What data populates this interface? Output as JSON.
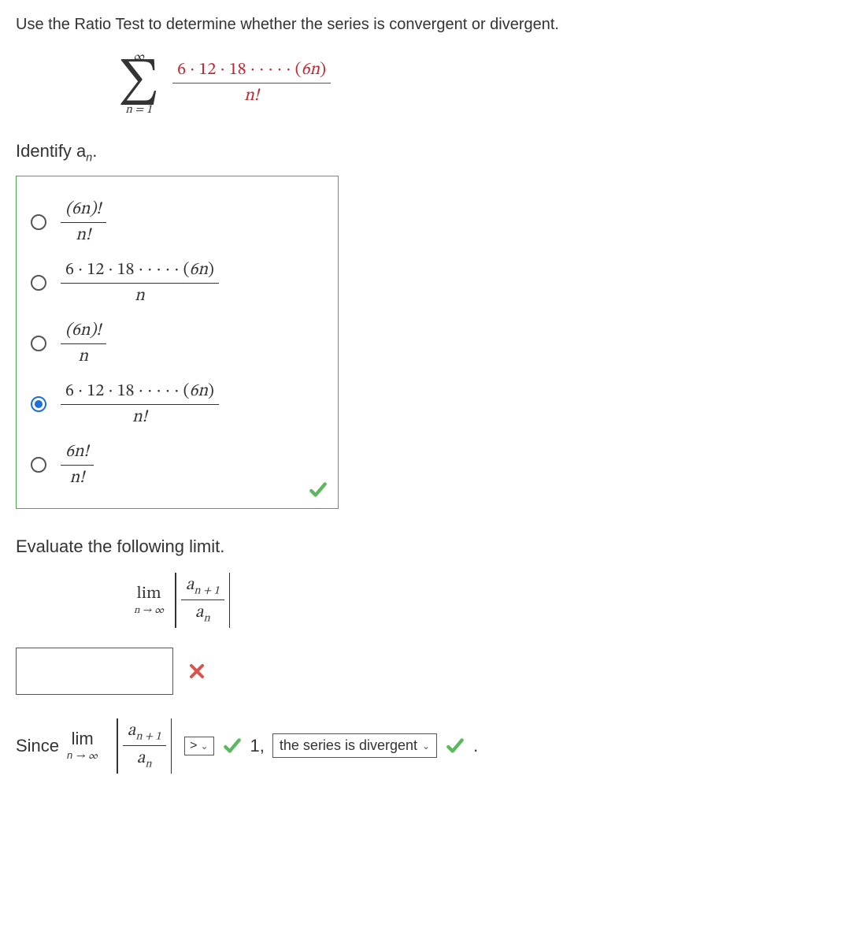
{
  "question": "Use the Ratio Test to determine whether the series is convergent or divergent.",
  "series": {
    "sigma_top": "∞",
    "sigma_bot": "n = 1",
    "numerator": "6 · 12 · 18 · · · · · (6n)",
    "denominator": "n!"
  },
  "identify_label": "Identify a",
  "identify_sub": "n",
  "identify_dot": ".",
  "options": [
    {
      "num": "(6n)!",
      "den": "n!",
      "selected": false
    },
    {
      "num": "6 · 12 · 18 · · · · · (6n)",
      "den": "n",
      "selected": false
    },
    {
      "num": "(6n)!",
      "den": "n",
      "selected": false
    },
    {
      "num": "6 · 12 · 18 · · · · · (6n)",
      "den": "n!",
      "selected": true
    },
    {
      "num": "6n!",
      "den": "n!",
      "selected": false
    }
  ],
  "evaluate_text": "Evaluate the following limit.",
  "limit": {
    "lim": "lim",
    "sub": "n → ∞",
    "ratio_num_base": "a",
    "ratio_num_sub": "n + 1",
    "ratio_den_base": "a",
    "ratio_den_sub": "n"
  },
  "since": {
    "word": "Since",
    "lim": "lim",
    "sub": "n → ∞",
    "compare_sym": ">",
    "one_comma": "1,",
    "conclusion": "the series is divergent",
    "period": "."
  }
}
